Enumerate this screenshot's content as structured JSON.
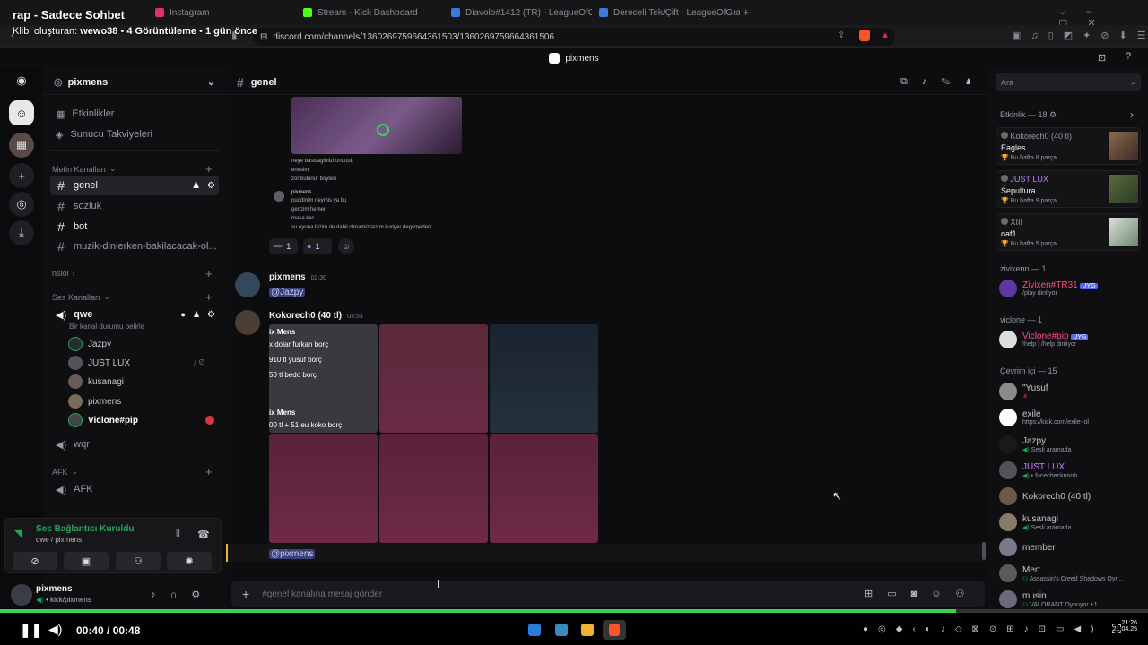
{
  "video": {
    "title": "rap - Sadece Sohbet",
    "clip_prefix": "Klibi oluşturan:",
    "clip_author": "wewo38",
    "views": "4 Görüntüleme",
    "ago": "1 gün önce",
    "time": "00:40 / 00:48",
    "progress": 0.833
  },
  "browser": {
    "tabs": [
      {
        "label": "Instagram",
        "color": "#e1306c"
      },
      {
        "label": "Stream - Kick Dashboard",
        "color": "#53fc18"
      },
      {
        "label": "Diavolo#1412 (TR) - LeagueOfGraphs",
        "color": "#3a7bd5"
      },
      {
        "label": "Dereceli Tek/Çift - LeagueOfGraphs",
        "color": "#3a7bd5"
      }
    ],
    "url": "discord.com/channels/1360269759664361503/1360269759664361506"
  },
  "discord": {
    "window_title": "pixmens",
    "server_name": "pixmens",
    "top_items": [
      "Etkinlikler",
      "Sunucu Takviyeleri"
    ],
    "text_category": "Metin Kanalları",
    "text_channels": [
      "genel",
      "sozluk",
      "bot",
      "muzik-dinlerken-bakilacacak-ol..."
    ],
    "nslol": "nslol",
    "voice_category": "Ses Kanalları",
    "voice_channel": "qwe",
    "voice_status": "Bir kanal durumu belirle",
    "voice_users": [
      "Jazpy",
      "JUST LUX",
      "kusanagi",
      "pixmens",
      "Viclone#pip"
    ],
    "wqr": "wqr",
    "afk_category": "AFK",
    "afk_channel": "AFK",
    "voice_connected": "Ses Bağlantısı Kuruldu",
    "voice_connected_sub": "qwe / pixmens",
    "user_name": "pixmens",
    "user_sub": "kick/pixmens",
    "channel_title": "genel",
    "search_placeholder": "Ara",
    "composer_placeholder": "#genel kanalına mesaj gönder"
  },
  "chat": {
    "quoted_lines": [
      "neye basicagimizi unuttuk",
      "enesim",
      "zor bulunur boylesi"
    ],
    "quoted_author": "pixmens",
    "quoted_lines2": [
      "puddinim neymis ya bu",
      "gerizim hemen",
      "masa kac",
      "su oyuna bizim de dahil olmamiz lazım kuriyer degsmeden"
    ],
    "reactions": [
      "1",
      "1"
    ],
    "msg1_author": "pixmens",
    "msg1_time": "02:30",
    "msg1_mention": "@Jazpy",
    "msg2_author": "Kokorech0 (40 tl)",
    "msg2_time": "03:53",
    "img1_lines": [
      "ix Mens",
      "x dolar furkan borç",
      "910 tl yusuf borç",
      "50 tl bedo borç",
      "ix Mens",
      "00 tl + 51 eu koko borç"
    ],
    "last_mention": "@pixmens"
  },
  "members": {
    "activity_header": "Etkinlik — 18",
    "activity": [
      {
        "user": "Kokorech0 (40 tl)",
        "title": "Eagles",
        "sub": "Bu hafta 8 parça",
        "color": "#c4c6ca"
      },
      {
        "user": "JUST LUX",
        "title": "Sepultura",
        "sub": "Bu hafta 9 parça",
        "color": "#c77dff"
      },
      {
        "user": "XIII",
        "title": "oaf1",
        "sub": "Bu hafta 5 parça",
        "color": "#c4c6ca"
      }
    ],
    "group1": "zivixenn — 1",
    "group2": "viclone — 1",
    "group3": "Çevrim içi — 15",
    "list": [
      {
        "name": "Zivixen#TR31",
        "sub": "/play dinliyor",
        "color": "#ff4b8b",
        "tag": "UYG"
      },
      {
        "name": "Viclone#pip",
        "sub": "!help | /help dinliyor",
        "color": "#ff4b8b",
        "tag": "UYG"
      },
      {
        "name": "\"Yusuf",
        "sub": "",
        "color": "#c4c6ca",
        "tag": ""
      },
      {
        "name": "exile",
        "sub": "https://kick.com/exile-lol",
        "color": "#c4c6ca",
        "tag": ""
      },
      {
        "name": "Jazpy",
        "sub": "Sesli aramada",
        "color": "#c4c6ca",
        "tag": ""
      },
      {
        "name": "JUST LUX",
        "sub": "facechecknoob",
        "color": "#c77dff",
        "tag": ""
      },
      {
        "name": "Kokorech0 (40 tl)",
        "sub": "",
        "color": "#c4c6ca",
        "tag": ""
      },
      {
        "name": "kusanagi",
        "sub": "Sesli aramada",
        "color": "#c4c6ca",
        "tag": ""
      },
      {
        "name": "member",
        "sub": "",
        "color": "#c4c6ca",
        "tag": ""
      },
      {
        "name": "Mert",
        "sub": "Assassin's Creed Shadows Oyn...",
        "color": "#c4c6ca",
        "tag": ""
      },
      {
        "name": "musin",
        "sub": "VALORANT Oynuyor +1",
        "color": "#c4c6ca",
        "tag": ""
      }
    ]
  },
  "taskbar": {
    "clock": "21:26",
    "date": "21.04.25"
  }
}
